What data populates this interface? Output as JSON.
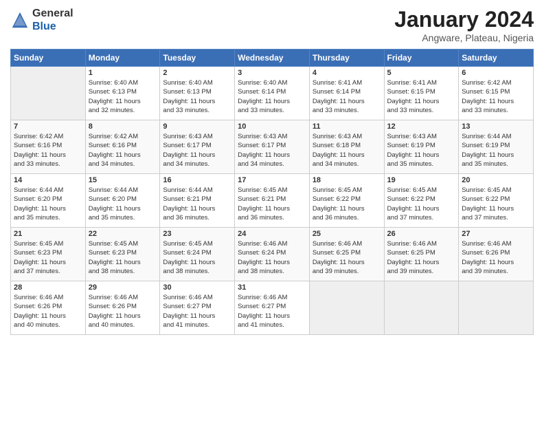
{
  "header": {
    "logo_general": "General",
    "logo_blue": "Blue",
    "month_title": "January 2024",
    "location": "Angware, Plateau, Nigeria"
  },
  "days_of_week": [
    "Sunday",
    "Monday",
    "Tuesday",
    "Wednesday",
    "Thursday",
    "Friday",
    "Saturday"
  ],
  "weeks": [
    [
      {
        "day": null
      },
      {
        "day": 1,
        "sunrise": "6:40 AM",
        "sunset": "6:13 PM",
        "daylight": "11 hours and 32 minutes."
      },
      {
        "day": 2,
        "sunrise": "6:40 AM",
        "sunset": "6:13 PM",
        "daylight": "11 hours and 33 minutes."
      },
      {
        "day": 3,
        "sunrise": "6:40 AM",
        "sunset": "6:14 PM",
        "daylight": "11 hours and 33 minutes."
      },
      {
        "day": 4,
        "sunrise": "6:41 AM",
        "sunset": "6:14 PM",
        "daylight": "11 hours and 33 minutes."
      },
      {
        "day": 5,
        "sunrise": "6:41 AM",
        "sunset": "6:15 PM",
        "daylight": "11 hours and 33 minutes."
      },
      {
        "day": 6,
        "sunrise": "6:42 AM",
        "sunset": "6:15 PM",
        "daylight": "11 hours and 33 minutes."
      }
    ],
    [
      {
        "day": 7,
        "sunrise": "6:42 AM",
        "sunset": "6:16 PM",
        "daylight": "11 hours and 33 minutes."
      },
      {
        "day": 8,
        "sunrise": "6:42 AM",
        "sunset": "6:16 PM",
        "daylight": "11 hours and 34 minutes."
      },
      {
        "day": 9,
        "sunrise": "6:43 AM",
        "sunset": "6:17 PM",
        "daylight": "11 hours and 34 minutes."
      },
      {
        "day": 10,
        "sunrise": "6:43 AM",
        "sunset": "6:17 PM",
        "daylight": "11 hours and 34 minutes."
      },
      {
        "day": 11,
        "sunrise": "6:43 AM",
        "sunset": "6:18 PM",
        "daylight": "11 hours and 34 minutes."
      },
      {
        "day": 12,
        "sunrise": "6:43 AM",
        "sunset": "6:19 PM",
        "daylight": "11 hours and 35 minutes."
      },
      {
        "day": 13,
        "sunrise": "6:44 AM",
        "sunset": "6:19 PM",
        "daylight": "11 hours and 35 minutes."
      }
    ],
    [
      {
        "day": 14,
        "sunrise": "6:44 AM",
        "sunset": "6:20 PM",
        "daylight": "11 hours and 35 minutes."
      },
      {
        "day": 15,
        "sunrise": "6:44 AM",
        "sunset": "6:20 PM",
        "daylight": "11 hours and 35 minutes."
      },
      {
        "day": 16,
        "sunrise": "6:44 AM",
        "sunset": "6:21 PM",
        "daylight": "11 hours and 36 minutes."
      },
      {
        "day": 17,
        "sunrise": "6:45 AM",
        "sunset": "6:21 PM",
        "daylight": "11 hours and 36 minutes."
      },
      {
        "day": 18,
        "sunrise": "6:45 AM",
        "sunset": "6:22 PM",
        "daylight": "11 hours and 36 minutes."
      },
      {
        "day": 19,
        "sunrise": "6:45 AM",
        "sunset": "6:22 PM",
        "daylight": "11 hours and 37 minutes."
      },
      {
        "day": 20,
        "sunrise": "6:45 AM",
        "sunset": "6:22 PM",
        "daylight": "11 hours and 37 minutes."
      }
    ],
    [
      {
        "day": 21,
        "sunrise": "6:45 AM",
        "sunset": "6:23 PM",
        "daylight": "11 hours and 37 minutes."
      },
      {
        "day": 22,
        "sunrise": "6:45 AM",
        "sunset": "6:23 PM",
        "daylight": "11 hours and 38 minutes."
      },
      {
        "day": 23,
        "sunrise": "6:45 AM",
        "sunset": "6:24 PM",
        "daylight": "11 hours and 38 minutes."
      },
      {
        "day": 24,
        "sunrise": "6:46 AM",
        "sunset": "6:24 PM",
        "daylight": "11 hours and 38 minutes."
      },
      {
        "day": 25,
        "sunrise": "6:46 AM",
        "sunset": "6:25 PM",
        "daylight": "11 hours and 39 minutes."
      },
      {
        "day": 26,
        "sunrise": "6:46 AM",
        "sunset": "6:25 PM",
        "daylight": "11 hours and 39 minutes."
      },
      {
        "day": 27,
        "sunrise": "6:46 AM",
        "sunset": "6:26 PM",
        "daylight": "11 hours and 39 minutes."
      }
    ],
    [
      {
        "day": 28,
        "sunrise": "6:46 AM",
        "sunset": "6:26 PM",
        "daylight": "11 hours and 40 minutes."
      },
      {
        "day": 29,
        "sunrise": "6:46 AM",
        "sunset": "6:26 PM",
        "daylight": "11 hours and 40 minutes."
      },
      {
        "day": 30,
        "sunrise": "6:46 AM",
        "sunset": "6:27 PM",
        "daylight": "11 hours and 41 minutes."
      },
      {
        "day": 31,
        "sunrise": "6:46 AM",
        "sunset": "6:27 PM",
        "daylight": "11 hours and 41 minutes."
      },
      {
        "day": null
      },
      {
        "day": null
      },
      {
        "day": null
      }
    ]
  ]
}
